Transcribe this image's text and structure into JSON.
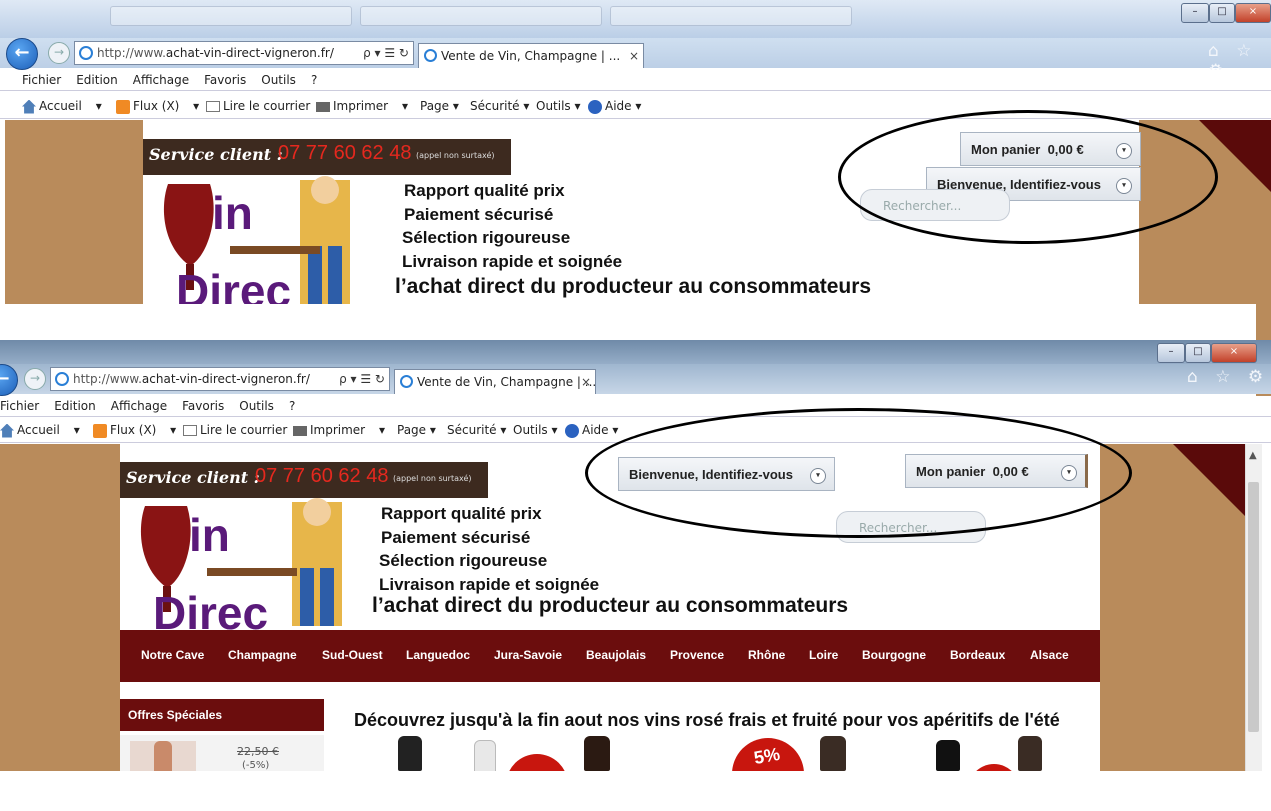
{
  "browser": {
    "url_prefix": "http://www.",
    "url_main": "achat-vin-direct-vigneron.fr/",
    "address_tools": "ρ ▾ ☰ ↻",
    "tab_title": "Vente de Vin, Champagne | ...",
    "tab_close": "×",
    "window_controls": [
      "–",
      "□",
      "×"
    ],
    "menu": [
      "Fichier",
      "Edition",
      "Affichage",
      "Favoris",
      "Outils",
      "?"
    ],
    "commands": {
      "accueil": "Accueil",
      "flux": "Flux (X)",
      "courrier": "Lire le courrier",
      "imprimer": "Imprimer",
      "page": "Page",
      "securite": "Sécurité",
      "outils": "Outils",
      "aide": "Aide"
    },
    "dropdown": "▾",
    "right_icons": "⌂ ☆ ⚙"
  },
  "site": {
    "service_label": "Service client :",
    "phone": "07 77 60 62 48",
    "phone_note": "(appel non surtaxé)",
    "logo_text_1": "in",
    "logo_text_2": "Direc",
    "slogans": [
      "Rapport qualité prix",
      "Paiement sécurisé",
      "Sélection rigoureuse",
      "Livraison rapide et soignée"
    ],
    "tagline": "l’achat direct du producteur au consommateurs",
    "cart_label": "Mon panier",
    "cart_amount": "0,00 €",
    "login_label": "Bienvenue, Identifiez-vous",
    "search_placeholder": "Rechercher...",
    "chevron": "▾"
  },
  "categories": [
    "Notre Cave",
    "Champagne",
    "Sud-Ouest",
    "Languedoc",
    "Jura-Savoie",
    "Beaujolais",
    "Provence",
    "Rhône",
    "Loire",
    "Bourgogne",
    "Bordeaux",
    "Alsace"
  ],
  "offers": {
    "title": "Offres Spéciales",
    "old_price": "22,50 €",
    "discount": "(-5%)"
  },
  "promo_banner": "Découvrez jusqu'à la fin aout nos vins rosé frais et fruité pour vos apéritifs de l'été",
  "badge_text": "5%",
  "colors": {
    "wine": "#6b0d0d",
    "phone_red": "#e5281e",
    "tan": "#b98b5b",
    "service_bg": "#3d2a1f"
  }
}
